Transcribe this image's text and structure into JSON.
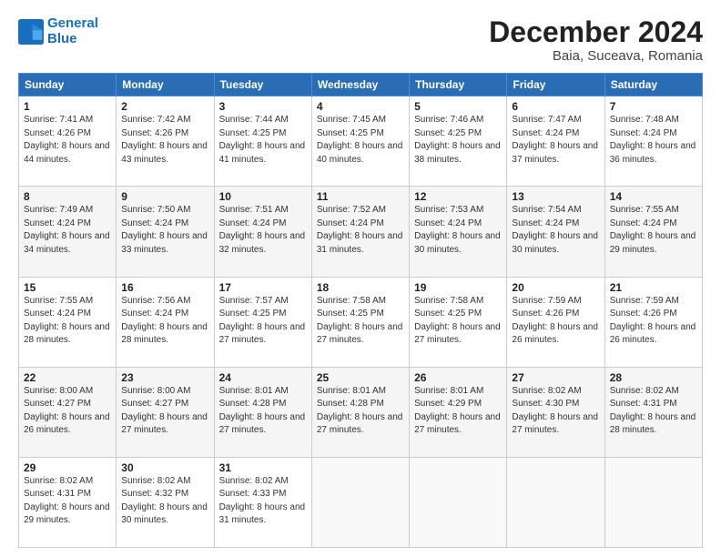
{
  "logo": {
    "line1": "General",
    "line2": "Blue"
  },
  "title": "December 2024",
  "subtitle": "Baia, Suceava, Romania",
  "days_header": [
    "Sunday",
    "Monday",
    "Tuesday",
    "Wednesday",
    "Thursday",
    "Friday",
    "Saturday"
  ],
  "weeks": [
    [
      {
        "day": "1",
        "sunrise": "7:41 AM",
        "sunset": "4:26 PM",
        "daylight": "8 hours and 44 minutes."
      },
      {
        "day": "2",
        "sunrise": "7:42 AM",
        "sunset": "4:26 PM",
        "daylight": "8 hours and 43 minutes."
      },
      {
        "day": "3",
        "sunrise": "7:44 AM",
        "sunset": "4:25 PM",
        "daylight": "8 hours and 41 minutes."
      },
      {
        "day": "4",
        "sunrise": "7:45 AM",
        "sunset": "4:25 PM",
        "daylight": "8 hours and 40 minutes."
      },
      {
        "day": "5",
        "sunrise": "7:46 AM",
        "sunset": "4:25 PM",
        "daylight": "8 hours and 38 minutes."
      },
      {
        "day": "6",
        "sunrise": "7:47 AM",
        "sunset": "4:24 PM",
        "daylight": "8 hours and 37 minutes."
      },
      {
        "day": "7",
        "sunrise": "7:48 AM",
        "sunset": "4:24 PM",
        "daylight": "8 hours and 36 minutes."
      }
    ],
    [
      {
        "day": "8",
        "sunrise": "7:49 AM",
        "sunset": "4:24 PM",
        "daylight": "8 hours and 34 minutes."
      },
      {
        "day": "9",
        "sunrise": "7:50 AM",
        "sunset": "4:24 PM",
        "daylight": "8 hours and 33 minutes."
      },
      {
        "day": "10",
        "sunrise": "7:51 AM",
        "sunset": "4:24 PM",
        "daylight": "8 hours and 32 minutes."
      },
      {
        "day": "11",
        "sunrise": "7:52 AM",
        "sunset": "4:24 PM",
        "daylight": "8 hours and 31 minutes."
      },
      {
        "day": "12",
        "sunrise": "7:53 AM",
        "sunset": "4:24 PM",
        "daylight": "8 hours and 30 minutes."
      },
      {
        "day": "13",
        "sunrise": "7:54 AM",
        "sunset": "4:24 PM",
        "daylight": "8 hours and 30 minutes."
      },
      {
        "day": "14",
        "sunrise": "7:55 AM",
        "sunset": "4:24 PM",
        "daylight": "8 hours and 29 minutes."
      }
    ],
    [
      {
        "day": "15",
        "sunrise": "7:55 AM",
        "sunset": "4:24 PM",
        "daylight": "8 hours and 28 minutes."
      },
      {
        "day": "16",
        "sunrise": "7:56 AM",
        "sunset": "4:24 PM",
        "daylight": "8 hours and 28 minutes."
      },
      {
        "day": "17",
        "sunrise": "7:57 AM",
        "sunset": "4:25 PM",
        "daylight": "8 hours and 27 minutes."
      },
      {
        "day": "18",
        "sunrise": "7:58 AM",
        "sunset": "4:25 PM",
        "daylight": "8 hours and 27 minutes."
      },
      {
        "day": "19",
        "sunrise": "7:58 AM",
        "sunset": "4:25 PM",
        "daylight": "8 hours and 27 minutes."
      },
      {
        "day": "20",
        "sunrise": "7:59 AM",
        "sunset": "4:26 PM",
        "daylight": "8 hours and 26 minutes."
      },
      {
        "day": "21",
        "sunrise": "7:59 AM",
        "sunset": "4:26 PM",
        "daylight": "8 hours and 26 minutes."
      }
    ],
    [
      {
        "day": "22",
        "sunrise": "8:00 AM",
        "sunset": "4:27 PM",
        "daylight": "8 hours and 26 minutes."
      },
      {
        "day": "23",
        "sunrise": "8:00 AM",
        "sunset": "4:27 PM",
        "daylight": "8 hours and 27 minutes."
      },
      {
        "day": "24",
        "sunrise": "8:01 AM",
        "sunset": "4:28 PM",
        "daylight": "8 hours and 27 minutes."
      },
      {
        "day": "25",
        "sunrise": "8:01 AM",
        "sunset": "4:28 PM",
        "daylight": "8 hours and 27 minutes."
      },
      {
        "day": "26",
        "sunrise": "8:01 AM",
        "sunset": "4:29 PM",
        "daylight": "8 hours and 27 minutes."
      },
      {
        "day": "27",
        "sunrise": "8:02 AM",
        "sunset": "4:30 PM",
        "daylight": "8 hours and 27 minutes."
      },
      {
        "day": "28",
        "sunrise": "8:02 AM",
        "sunset": "4:31 PM",
        "daylight": "8 hours and 28 minutes."
      }
    ],
    [
      {
        "day": "29",
        "sunrise": "8:02 AM",
        "sunset": "4:31 PM",
        "daylight": "8 hours and 29 minutes."
      },
      {
        "day": "30",
        "sunrise": "8:02 AM",
        "sunset": "4:32 PM",
        "daylight": "8 hours and 30 minutes."
      },
      {
        "day": "31",
        "sunrise": "8:02 AM",
        "sunset": "4:33 PM",
        "daylight": "8 hours and 31 minutes."
      },
      null,
      null,
      null,
      null
    ]
  ]
}
